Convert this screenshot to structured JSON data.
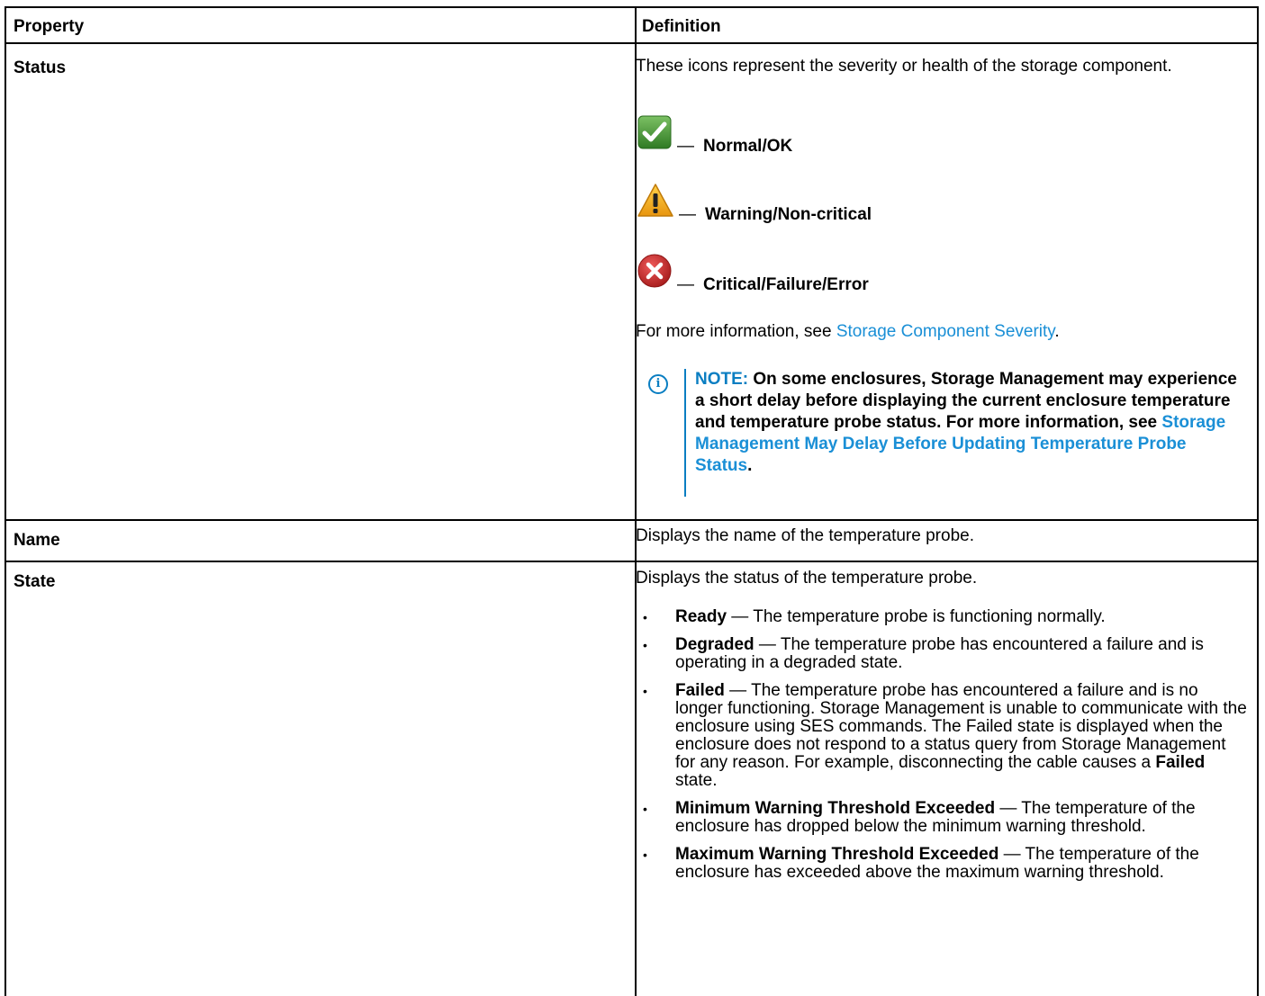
{
  "table": {
    "header": {
      "property": "Property",
      "definition": "Definition"
    },
    "status": {
      "label": "Status",
      "intro": "These icons represent the severity or health of the storage component.",
      "icons": [
        {
          "icon": "check-icon",
          "dash": "—",
          "text": "Normal/OK",
          "color": "#3d8a2e"
        },
        {
          "icon": "warning-icon",
          "dash": "—",
          "text": "Warning/Non-critical",
          "color": "#f0a81c"
        },
        {
          "icon": "error-icon",
          "dash": "—",
          "text": "Critical/Failure/Error",
          "color": "#c62828"
        }
      ],
      "more_info_prefix": "For more information, see ",
      "more_info_link": "Storage Component Severity",
      "more_info_suffix": ".",
      "note": {
        "label": "NOTE:",
        "text": " On some enclosures, Storage Management may experience a short delay before displaying the current enclosure temperature and temperature probe status. For more information, see ",
        "link": "Storage Management May Delay Before Updating Temperature Probe Status",
        "suffix": "."
      }
    },
    "name": {
      "label": "Name",
      "definition": "Displays the name of the temperature probe."
    },
    "state": {
      "label": "State",
      "intro": "Displays the status of the temperature probe.",
      "items": [
        {
          "term": "Ready",
          "desc": " — The temperature probe is functioning normally."
        },
        {
          "term": "Degraded",
          "desc": " — The temperature probe has encountered a failure and is operating in a degraded state."
        },
        {
          "term": "Failed",
          "desc": " — The temperature probe has encountered a failure and is no longer functioning. Storage Management is unable to communicate with the enclosure using SES commands. The Failed state is displayed when the enclosure does not respond to a status query from Storage Management for any reason. For example, disconnecting the cable causes a ",
          "term2": "Failed",
          "desc2": " state."
        },
        {
          "term": "Minimum Warning Threshold Exceeded",
          "desc": " — The temperature of the enclosure has dropped below the minimum warning threshold."
        },
        {
          "term": "Maximum Warning Threshold Exceeded",
          "desc": " — The temperature of the enclosure has exceeded above the maximum warning threshold."
        }
      ]
    }
  },
  "colors": {
    "link": "#1a8fd6",
    "note": "#0a7ec2"
  }
}
